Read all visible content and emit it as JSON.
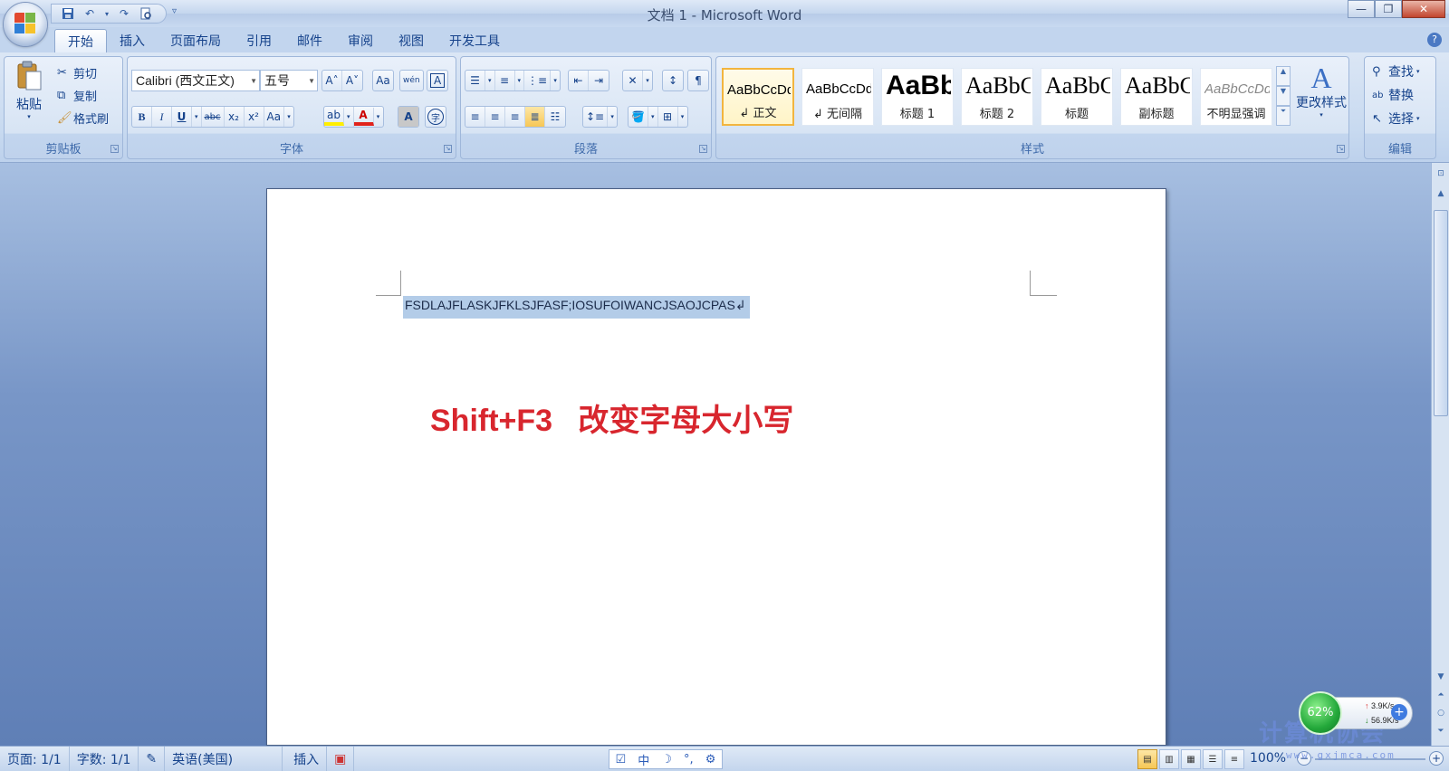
{
  "window": {
    "title": "文档 1 - Microsoft Word",
    "minimize": "—",
    "restore": "❐",
    "close": "✕"
  },
  "qat": {
    "save_icon": "save-icon",
    "undo_icon": "undo-icon",
    "redo_icon": "redo-icon",
    "preview_icon": "print-preview-icon",
    "more": "▿"
  },
  "tabs": [
    "开始",
    "插入",
    "页面布局",
    "引用",
    "邮件",
    "审阅",
    "视图",
    "开发工具"
  ],
  "ribbon": {
    "clipboard": {
      "label": "剪贴板",
      "paste": "粘贴",
      "cut": "剪切",
      "copy": "复制",
      "format_painter": "格式刷"
    },
    "font": {
      "label": "字体",
      "font_name": "Calibri (西文正文)",
      "font_size": "五号",
      "grow": "A˄",
      "shrink": "A˅",
      "clear": "Aa",
      "phonetic": "wén",
      "border": "A",
      "bold": "B",
      "italic": "I",
      "underline": "U",
      "strike": "abc",
      "subscript": "x₂",
      "superscript": "x²",
      "change_case": "Aa",
      "highlight": "ab",
      "font_color": "A",
      "char_shade": "A",
      "enclose": "字"
    },
    "paragraph": {
      "label": "段落"
    },
    "styles": {
      "label": "样式",
      "items": [
        {
          "sample": "AaBbCcDd",
          "name": "↲ 正文"
        },
        {
          "sample": "AaBbCcDd",
          "name": "↲ 无间隔"
        },
        {
          "sample": "AaBb",
          "name": "标题 1"
        },
        {
          "sample": "AaBbC",
          "name": "标题 2"
        },
        {
          "sample": "AaBbC",
          "name": "标题"
        },
        {
          "sample": "AaBbC",
          "name": "副标题"
        },
        {
          "sample": "AaBbCcDd",
          "name": "不明显强调"
        }
      ],
      "change_styles": "更改样式"
    },
    "editing": {
      "label": "编辑",
      "find": "查找",
      "replace": "替换",
      "select": "选择"
    }
  },
  "document": {
    "selected_line": "FSDLAJFLASKJFKLSJFASF;IOSUFOIWANCJSAOJCPAS↲",
    "big_text": "Shift+F3   改变字母大小写"
  },
  "netwidget": {
    "percent": "62%",
    "up": "3.9K/s",
    "down": "56.9K/s",
    "plus": "+"
  },
  "watermark": {
    "text": "计算机协会",
    "url": "www.gxjmca.com"
  },
  "statusbar": {
    "page": "页面: 1/1",
    "words": "字数: 1/1",
    "language": "英语(美国)",
    "insert": "插入",
    "ime": [
      "中",
      "☽",
      "°,",
      "⚙"
    ],
    "zoom": "100%"
  },
  "colors": {
    "accent_text": "#15428b",
    "big_text_red": "#d8262e",
    "selection": "#b3cce8"
  }
}
